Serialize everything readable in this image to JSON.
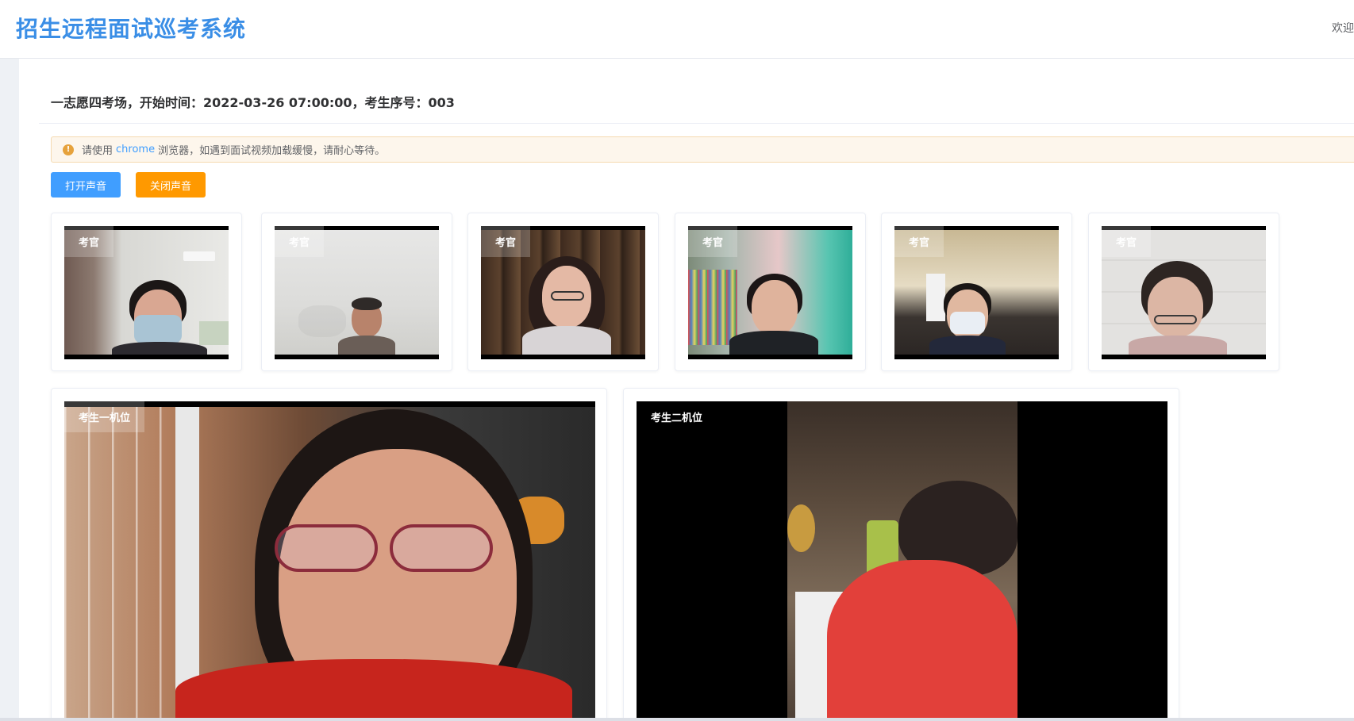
{
  "header": {
    "title": "招生远程面试巡考系统",
    "welcome": "欢迎"
  },
  "session": {
    "info": "一志愿四考场，开始时间：2022-03-26 07:00:00，考生序号：003"
  },
  "alert": {
    "prefix": "请使用",
    "link": "chrome",
    "suffix": "浏览器，如遇到面试视频加载缓慢，请耐心等待。"
  },
  "buttons": {
    "open_sound": "打开声音",
    "close_sound": "关闭声音"
  },
  "examiners": [
    {
      "label": "考官"
    },
    {
      "label": "考官"
    },
    {
      "label": "考官"
    },
    {
      "label": "考官"
    },
    {
      "label": "考官"
    },
    {
      "label": "考官"
    }
  ],
  "candidate_views": [
    {
      "label": "考生一机位"
    },
    {
      "label": "考生二机位"
    }
  ]
}
